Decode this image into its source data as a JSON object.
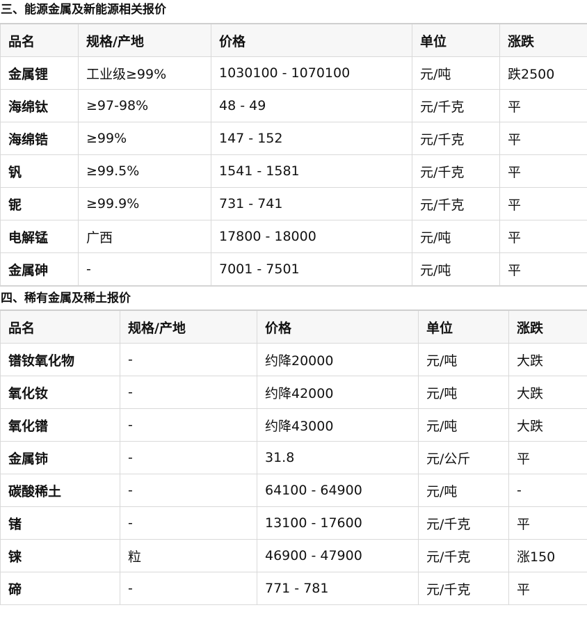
{
  "section1": {
    "title": "三、能源金属及新能源相关报价",
    "headers": [
      "品名",
      "规格/产地",
      "价格",
      "单位",
      "涨跌"
    ],
    "rows": [
      [
        "金属锂",
        "工业级≥99%",
        "1030100 - 1070100",
        "元/吨",
        "跌2500"
      ],
      [
        "海绵钛",
        "≥97-98%",
        "48 - 49",
        "元/千克",
        "平"
      ],
      [
        "海绵锆",
        "≥99%",
        "147 - 152",
        "元/千克",
        "平"
      ],
      [
        "钒",
        "≥99.5%",
        "1541 - 1581",
        "元/千克",
        "平"
      ],
      [
        "铌",
        "≥99.9%",
        "731 - 741",
        "元/千克",
        "平"
      ],
      [
        "电解锰",
        "广西",
        "17800 - 18000",
        "元/吨",
        "平"
      ],
      [
        "金属砷",
        "-",
        "7001 - 7501",
        "元/吨",
        "平"
      ]
    ]
  },
  "section2": {
    "title": "四、稀有金属及稀土报价",
    "headers": [
      "品名",
      "规格/产地",
      "价格",
      "单位",
      "涨跌"
    ],
    "rows": [
      [
        "镨钕氧化物",
        "-",
        "约降20000",
        "元/吨",
        "大跌"
      ],
      [
        "氧化钕",
        "-",
        "约降42000",
        "元/吨",
        "大跌"
      ],
      [
        "氧化镨",
        "-",
        "约降43000",
        "元/吨",
        "大跌"
      ],
      [
        "金属铈",
        "-",
        "31.8",
        "元/公斤",
        "平"
      ],
      [
        "碳酸稀土",
        "-",
        "64100 - 64900",
        "元/吨",
        "-"
      ],
      [
        "锗",
        "-",
        "13100 - 17600",
        "元/千克",
        "平"
      ],
      [
        "铼",
        "粒",
        "46900 - 47900",
        "元/千克",
        "涨150"
      ],
      [
        "碲",
        "-",
        "771 - 781",
        "元/千克",
        "平"
      ]
    ]
  }
}
